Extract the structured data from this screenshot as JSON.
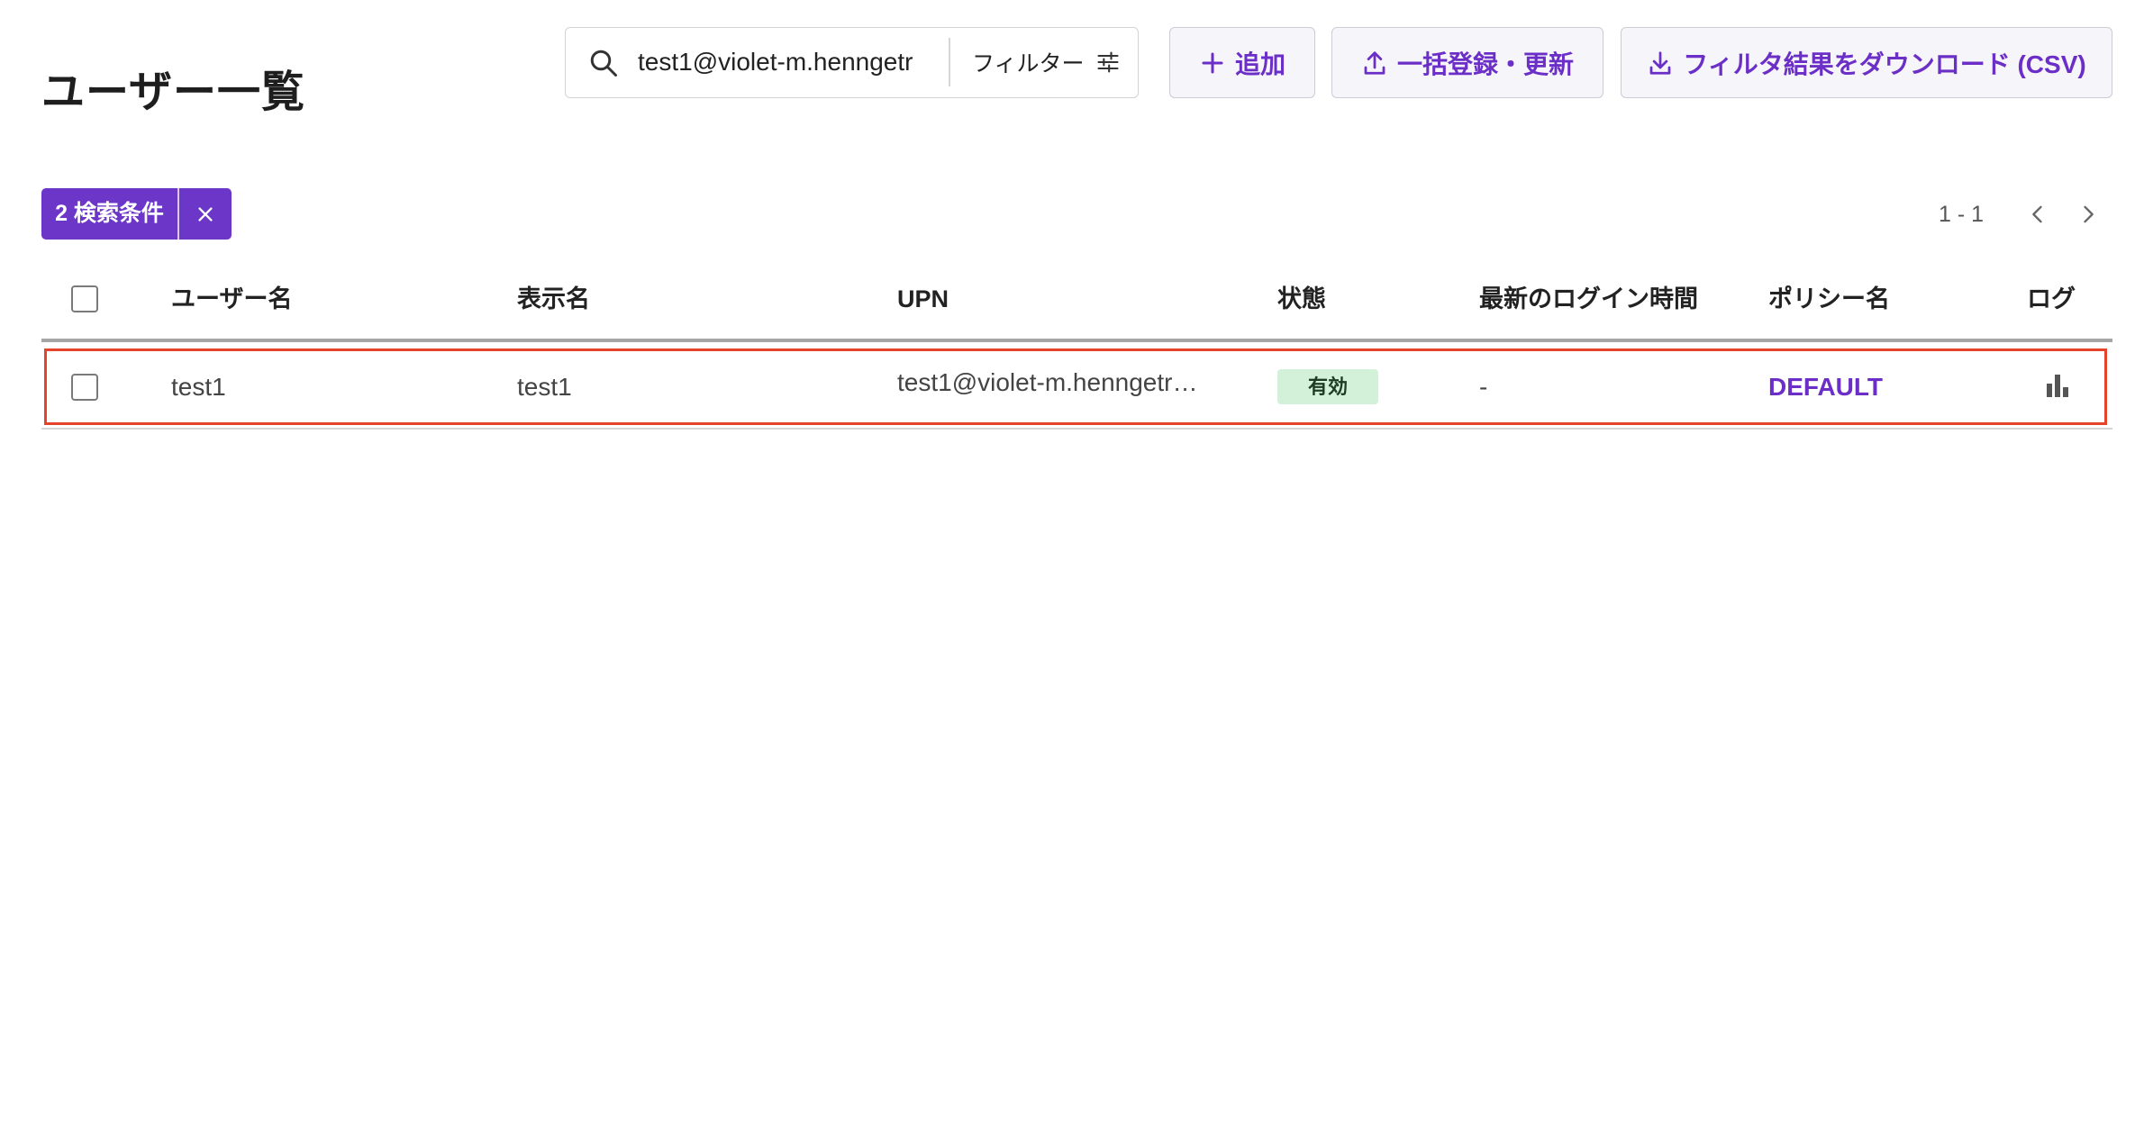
{
  "page": {
    "title": "ユーザー一覧"
  },
  "search": {
    "value": "test1@violet-m.henngetr",
    "icon": "search-icon",
    "filter_label": "フィルター",
    "filter_icon": "sliders-icon"
  },
  "actions": {
    "add_label": "追加",
    "add_icon": "plus-icon",
    "bulk_label": "一括登録・更新",
    "bulk_icon": "upload-icon",
    "download_label": "フィルタ結果をダウンロード (CSV)",
    "download_icon": "download-icon"
  },
  "filter_chip": {
    "label": "2 検索条件",
    "clear_icon": "close-icon"
  },
  "pagination": {
    "range": "1 - 1",
    "prev_icon": "chevron-left-icon",
    "next_icon": "chevron-right-icon"
  },
  "table": {
    "columns": [
      "ユーザー名",
      "表示名",
      "UPN",
      "状態",
      "最新のログイン時間",
      "ポリシー名",
      "ログ"
    ],
    "rows": [
      {
        "username": "test1",
        "display_name": "test1",
        "upn": "test1@violet-m.henngetr…",
        "status": "有効",
        "last_login": "-",
        "policy": "DEFAULT",
        "log_icon": "bar-chart-icon",
        "selected": false
      }
    ]
  },
  "colors": {
    "accent": "#6b2fc7",
    "chip_bg": "#6c36c8",
    "status_active_bg": "#d2f1d8",
    "highlight": "#e5432a"
  }
}
